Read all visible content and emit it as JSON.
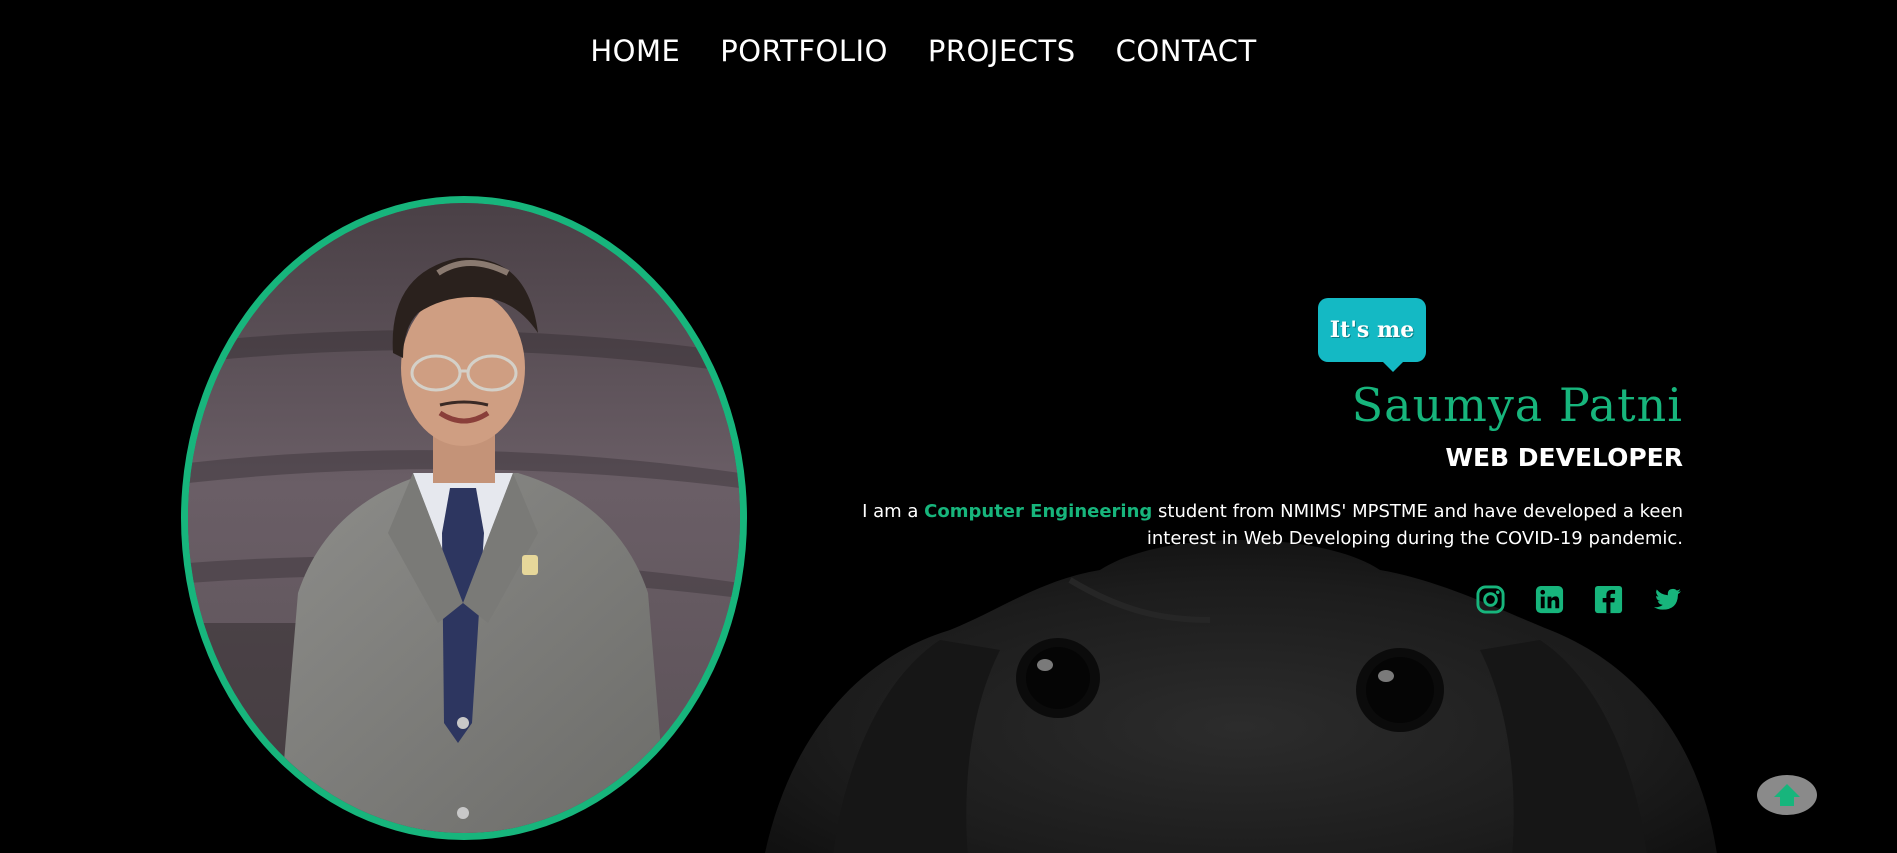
{
  "nav": {
    "items": [
      {
        "label": "HOME"
      },
      {
        "label": "PORTFOLIO"
      },
      {
        "label": "PROJECTS"
      },
      {
        "label": "CONTACT"
      }
    ]
  },
  "hero": {
    "bubble_text": "It's me",
    "name": "Saumya Patni",
    "role": "WEB DEVELOPER",
    "bio": {
      "prefix": "I am a ",
      "highlight": "Computer Engineering",
      "suffix": " student from NMIMS' MPSTME and have developed a keen interest in Web Developing during the COVID-19 pandemic."
    },
    "socials": [
      {
        "icon": "instagram-icon"
      },
      {
        "icon": "linkedin-icon"
      },
      {
        "icon": "facebook-icon"
      },
      {
        "icon": "twitter-icon"
      }
    ]
  },
  "scroll_top": {
    "icon": "arrow-up-icon"
  },
  "colors": {
    "accent": "#17b57c",
    "bubble": "#14b9c4",
    "background": "#000000",
    "scroll_button": "#8a8a8a"
  }
}
